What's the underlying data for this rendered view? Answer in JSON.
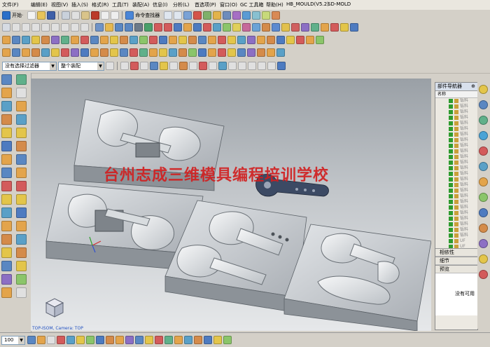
{
  "menu": {
    "items": [
      "文件(F)",
      "编辑(E)",
      "视图(V)",
      "插入(S)",
      "格式(R)",
      "工具(T)",
      "装配(A)",
      "信息(I)",
      "分析(L)",
      "首选项(P)",
      "窗口(O)",
      "GC 工具箱",
      "帮助(H)",
      "HB_MOULD(V5.2)",
      "SD-MOLD"
    ]
  },
  "toolbar": {
    "start_label": "开始·",
    "command_finder_label": "命令查找器",
    "selection_filter": "没有选择过滤器",
    "assembly_scope": "整个装配",
    "zoom_value": "100"
  },
  "viewport": {
    "watermark": "台州志成三维模具编程培训学校",
    "view_label": "TOP-ISOM, Camera: TOP"
  },
  "navigator": {
    "title": "部件导航器",
    "column_name": "名称",
    "rows": [
      "钣料",
      "钣料",
      "钣料",
      "钣料",
      "钣料",
      "钣料",
      "钣料",
      "钣料",
      "钣料",
      "钣料",
      "钣料",
      "钣料",
      "钣料",
      "钣料",
      "钣料",
      "钣料",
      "钣料",
      "钣料",
      "钣料",
      "钣料",
      "钣料",
      "钣料",
      "钣料",
      "钣料",
      "钣料",
      "UF",
      "UF",
      "UF",
      "UF"
    ],
    "sections": [
      "相依性",
      "细节",
      "预览"
    ],
    "empty_text": "没有可用"
  },
  "colors": {
    "watermark": "#d21d1d",
    "viewport_top": "#9aa0a6",
    "viewport_bottom": "#e6e8ea",
    "tool_green": "#2e9b2e",
    "mold_steel": "#c8ccd0"
  },
  "icons": [
    "start-icon",
    "save-icon",
    "undo-icon",
    "redo-icon",
    "command-finder-icon",
    "select-icon",
    "snap-icon",
    "sketch-icon",
    "extrude-icon",
    "revolve-icon",
    "hole-icon",
    "blend-icon",
    "chamfer-icon",
    "shell-icon",
    "mirror-icon",
    "analysis-icon",
    "layer-icon",
    "fit-icon",
    "zoom-icon",
    "rotate-icon",
    "pan-icon",
    "render-icon",
    "camera-icon",
    "text-icon",
    "line-icon",
    "arc-icon",
    "circle-icon",
    "point-icon",
    "plane-icon",
    "datum-icon",
    "csys-icon",
    "measure-icon",
    "mold-icon",
    "insert-icon",
    "slider-icon",
    "ejector-icon",
    "cooling-icon",
    "gate-icon",
    "runner-icon",
    "electrode-icon",
    "part-navigator-icon",
    "assembly-navigator-icon",
    "history-icon",
    "roles-icon",
    "web-icon",
    "palette-icon",
    "help-icon"
  ]
}
